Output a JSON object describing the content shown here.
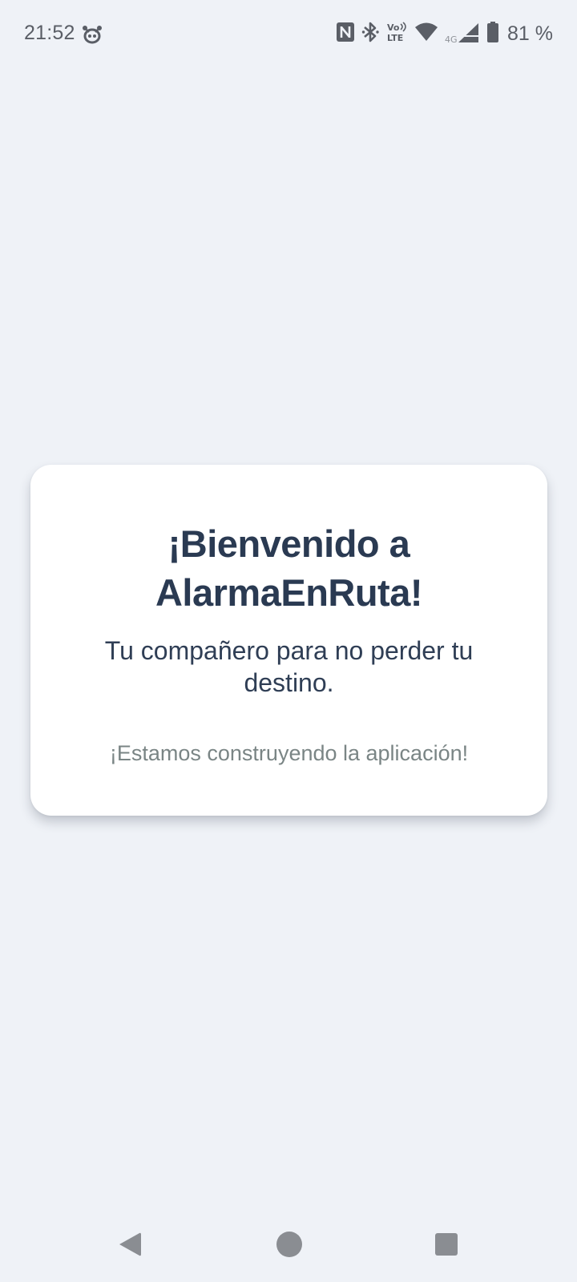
{
  "status_bar": {
    "time": "21:52",
    "battery_percent": "81 %",
    "icons": [
      "app-notification-icon",
      "nfc-icon",
      "bluetooth-icon",
      "volte-icon",
      "wifi-icon",
      "signal-4g-icon",
      "battery-icon"
    ],
    "network_label": "4G",
    "volte_label_top": "Vo",
    "volte_label_bottom": "LTE"
  },
  "card": {
    "title": "¡Bienvenido a AlarmaEnRuta!",
    "subtitle": "Tu compañero para no perder tu destino.",
    "note": "¡Estamos construyendo la aplicación!"
  },
  "navigation": {
    "buttons": [
      "back-icon",
      "home-icon",
      "recents-icon"
    ]
  },
  "colors": {
    "background": "#eff2f7",
    "card": "#ffffff",
    "title": "#2a3a52",
    "subtitle": "#2f3e55",
    "note": "#7a8585",
    "system_icons": "#5a5e66",
    "nav_icons": "#8a8d92"
  }
}
